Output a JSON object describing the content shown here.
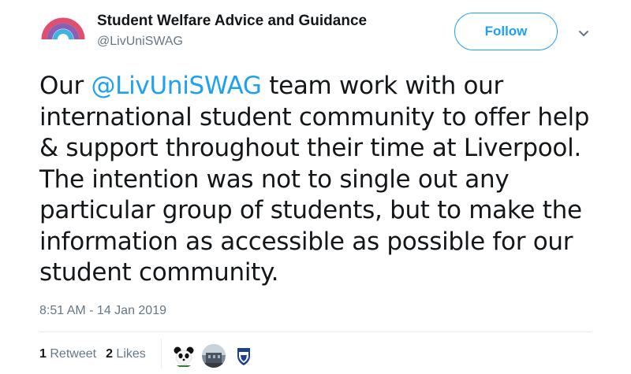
{
  "account": {
    "display_name": "Student Welfare Advice and Guidance",
    "handle": "@LivUniSWAG",
    "avatar_icon": "rainbow-arc-logo-icon"
  },
  "follow_label": "Follow",
  "menu_icon": "chevron-down-icon",
  "tweet": {
    "before_mention": "Our ",
    "mention": "@LivUniSWAG",
    "after_mention": " team work with our international student community to offer help & support throughout their time at Liverpool. The intention was not to single out any particular group of students, but to make the information as accessible as possible for our student community."
  },
  "timestamp": "8:51 AM - 14 Jan 2019",
  "stats": {
    "retweets_count": "1",
    "retweets_label": "Retweet",
    "likes_count": "2",
    "likes_label": "Likes"
  },
  "likers": [
    "panda-avatar-icon",
    "building-avatar-icon",
    "shield-crest-avatar-icon"
  ],
  "colors": {
    "accent": "#1da1f2",
    "secondary_text": "#657786",
    "divider": "#e6ecf0"
  }
}
